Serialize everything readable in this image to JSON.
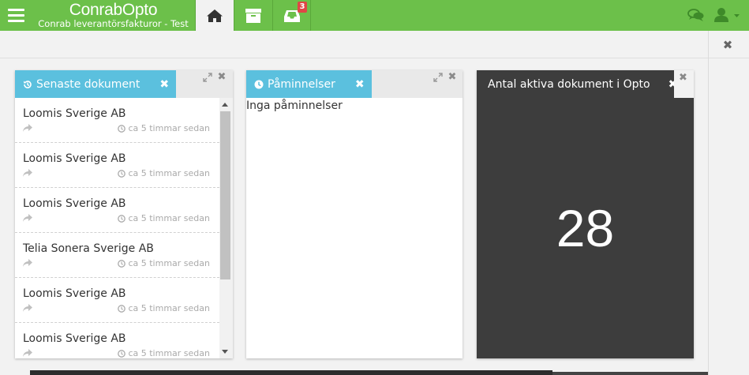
{
  "app": {
    "brand_name": "ConrabOpto",
    "brand_subtitle": "Conrab leverantörsfakturor - Test",
    "inbox_badge": "3"
  },
  "colors": {
    "topbar": "#6cc04a",
    "widget_title": "#5bc0de",
    "dark_widget": "#3d3d3d"
  },
  "icons": {
    "menu": "hamburger-icon",
    "home": "home-icon",
    "archive": "archive-icon",
    "inbox": "inbox-icon",
    "chat": "chat-icon",
    "user": "user-icon"
  },
  "widgets": {
    "recent": {
      "title": "Senaste dokument",
      "close": "✖",
      "items": [
        {
          "company": "Loomis Sverige AB",
          "time": "ca 5 timmar sedan"
        },
        {
          "company": "Loomis Sverige AB",
          "time": "ca 5 timmar sedan"
        },
        {
          "company": "Loomis Sverige AB",
          "time": "ca 5 timmar sedan"
        },
        {
          "company": "Telia Sonera Sverige AB",
          "time": "ca 5 timmar sedan"
        },
        {
          "company": "Loomis Sverige AB",
          "time": "ca 5 timmar sedan"
        },
        {
          "company": "Loomis Sverige AB",
          "time": "ca 5 timmar sedan"
        }
      ]
    },
    "reminders": {
      "title": "Påminnelser",
      "close": "✖",
      "empty_text": "Inga påminnelser"
    },
    "active": {
      "title": "Antal aktiva dokument i Opto",
      "close": "✖",
      "count": "28"
    }
  }
}
